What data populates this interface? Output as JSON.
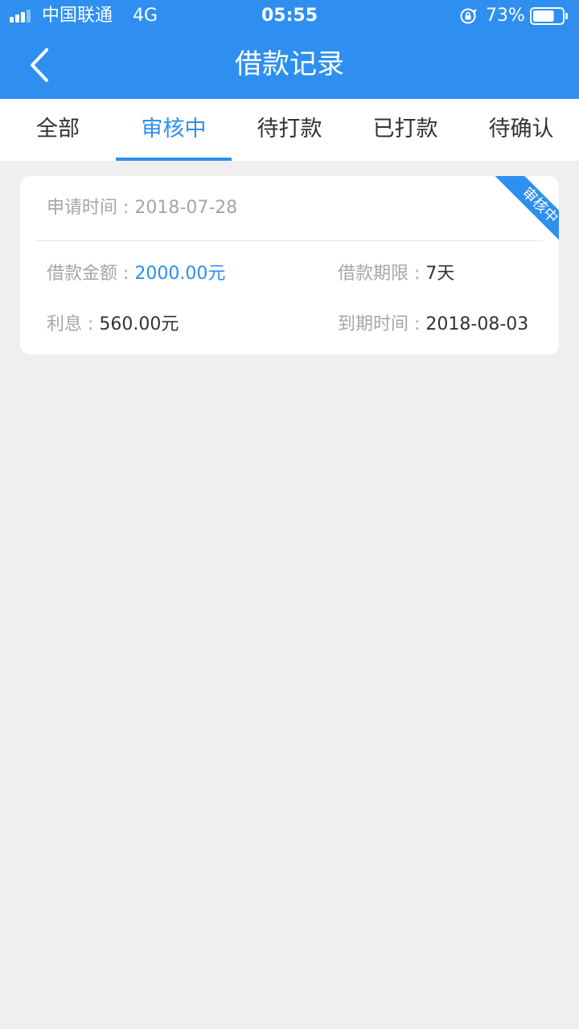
{
  "status_bar": {
    "carrier": "中国联通",
    "network": "4G",
    "time": "05:55",
    "battery_percent": "73%",
    "battery_level": 0.73
  },
  "nav": {
    "title": "借款记录",
    "back_icon": "chevron-left-icon"
  },
  "tabs": [
    {
      "label": "全部",
      "active": false
    },
    {
      "label": "审核中",
      "active": true
    },
    {
      "label": "待打款",
      "active": false
    },
    {
      "label": "已打款",
      "active": false
    },
    {
      "label": "待确认",
      "active": false
    }
  ],
  "record": {
    "apply_time_label": "申请时间 : ",
    "apply_time": "2018-07-28",
    "amount_label": "借款金额 : ",
    "amount": "2000.00元",
    "term_label": "借款期限 : ",
    "term": "7天",
    "interest_label": "利息 : ",
    "interest": "560.00元",
    "due_label": "到期时间 : ",
    "due": "2018-08-03",
    "status_badge": "审核中"
  },
  "colors": {
    "accent": "#2e8ff0",
    "background": "#efefef",
    "card": "#ffffff",
    "label_gray": "#a6a6a6",
    "text_dark": "#333333"
  }
}
